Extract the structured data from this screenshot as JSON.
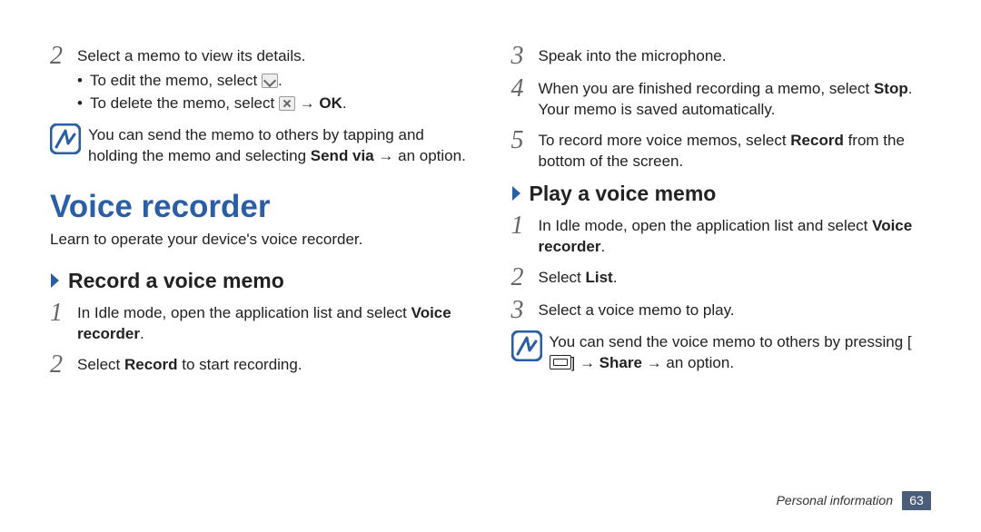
{
  "left": {
    "step2": {
      "num": "2",
      "text": "Select a memo to view its details.",
      "bullets": [
        {
          "pre": "To edit the memo, select ",
          "icon": "edit",
          "post": "."
        },
        {
          "pre": "To delete the memo, select ",
          "icon": "delete",
          "post": " → ",
          "bold": "OK",
          "tail": "."
        }
      ]
    },
    "note1": "You can send the memo to others by tapping and holding the memo and selecting ",
    "note1_bold": "Send via",
    "note1_tail": " → an option.",
    "h1": "Voice recorder",
    "h1_sub": "Learn to operate your device's voice recorder.",
    "h2_record": "Record a voice memo",
    "rec_step1": {
      "num": "1",
      "pre": "In Idle mode, open the application list and select ",
      "bold": "Voice recorder",
      "tail": "."
    },
    "rec_step2": {
      "num": "2",
      "pre": "Select ",
      "bold": "Record",
      "tail": " to start recording."
    }
  },
  "right": {
    "step3": {
      "num": "3",
      "text": "Speak into the microphone."
    },
    "step4": {
      "num": "4",
      "pre": "When you are finished recording a memo, select ",
      "bold": "Stop",
      "tail": ". Your memo is saved automatically."
    },
    "step5": {
      "num": "5",
      "pre": "To record more voice memos, select ",
      "bold": "Record",
      "tail": " from the bottom of the screen."
    },
    "h2_play": "Play a voice memo",
    "play_step1": {
      "num": "1",
      "pre": "In Idle mode, open the application list and select ",
      "bold": "Voice recorder",
      "tail": "."
    },
    "play_step2": {
      "num": "2",
      "pre": "Select ",
      "bold": "List",
      "tail": "."
    },
    "play_step3": {
      "num": "3",
      "text": "Select a voice memo to play."
    },
    "note2_pre": "You can send the voice memo to others by pressing [",
    "note2_mid": "] → ",
    "note2_bold": "Share",
    "note2_tail": " → an option."
  },
  "footer": {
    "section": "Personal information",
    "page": "63"
  }
}
